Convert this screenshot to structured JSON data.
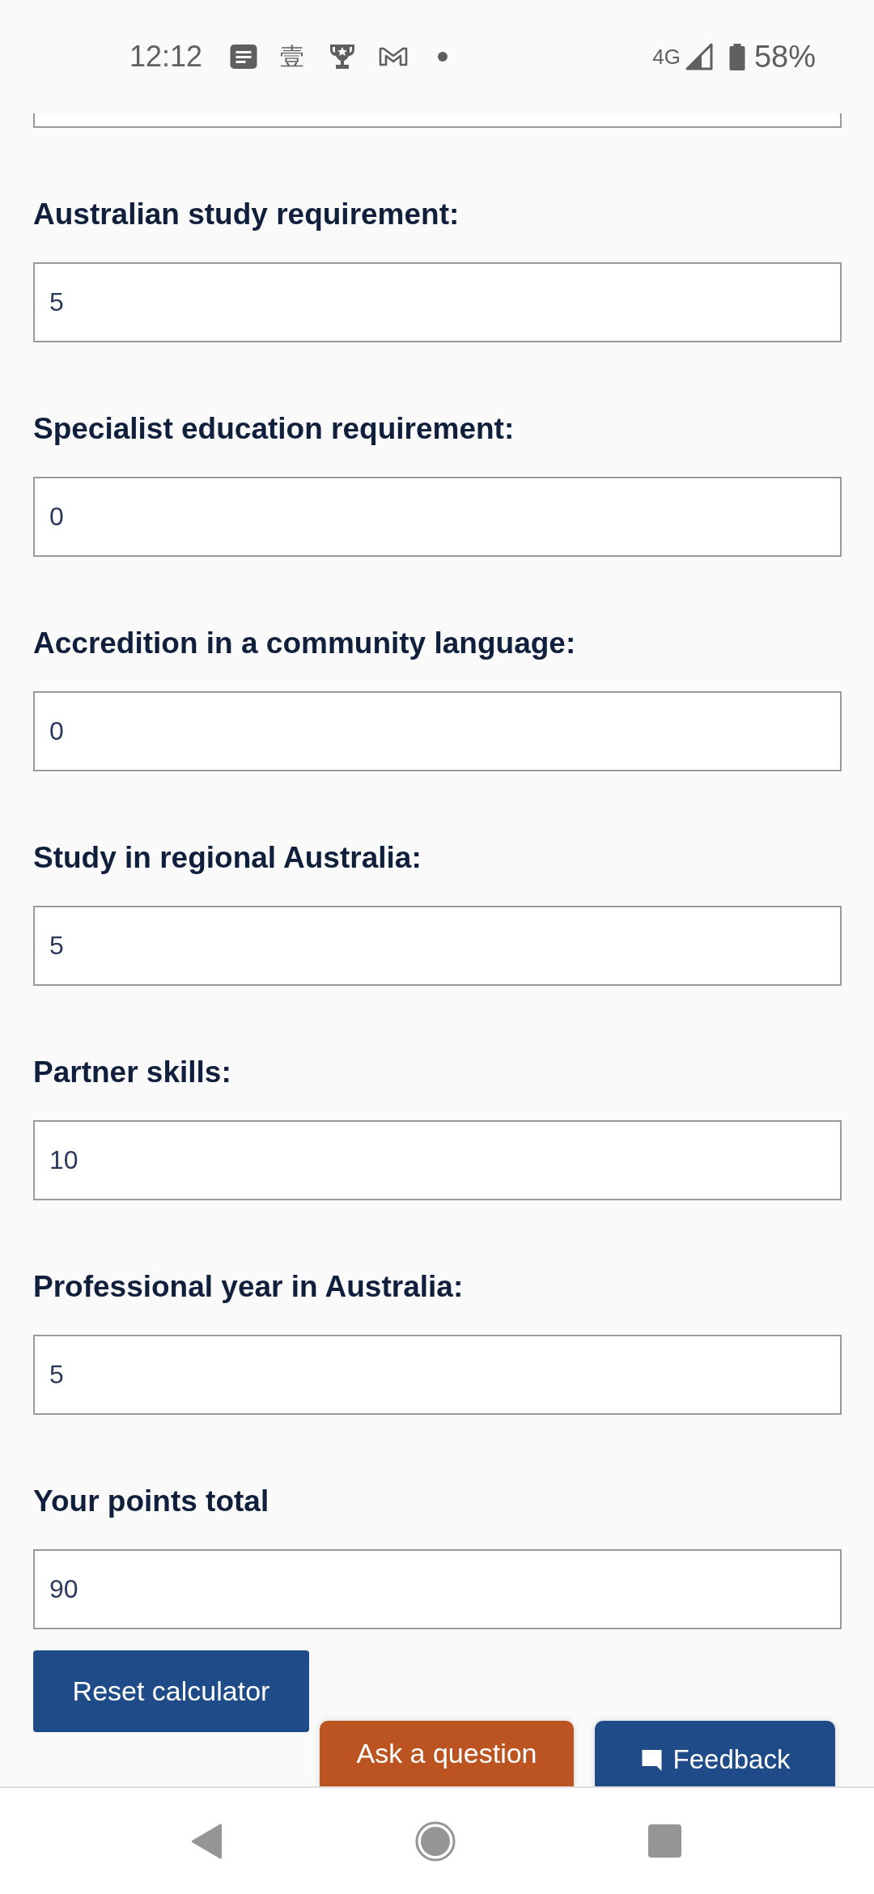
{
  "status_bar": {
    "time": "12:12",
    "notification_glyph": "壹",
    "network": "4G",
    "battery": "58%"
  },
  "fields": [
    {
      "label": "Australian study requirement:",
      "value": "5"
    },
    {
      "label": "Specialist education requirement:",
      "value": "0"
    },
    {
      "label": "Accredition in a community language:",
      "value": "0"
    },
    {
      "label": "Study in regional Australia:",
      "value": "5"
    },
    {
      "label": "Partner skills:",
      "value": "10"
    },
    {
      "label": "Professional year in Australia:",
      "value": "5"
    },
    {
      "label": "Your points total",
      "value": "90"
    }
  ],
  "reset_button": "Reset calculator",
  "floating_buttons": [
    {
      "kind": "ask",
      "label": "Ask a question"
    },
    {
      "kind": "feedback",
      "label": "Feedback"
    }
  ]
}
